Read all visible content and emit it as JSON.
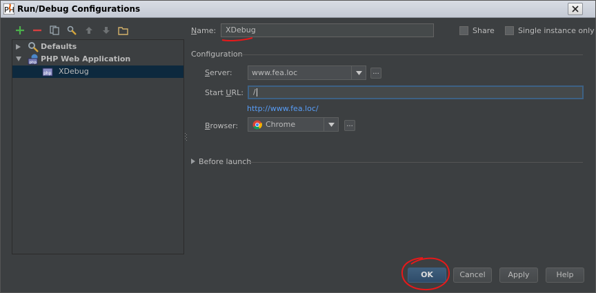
{
  "window": {
    "title": "Run/Debug Configurations"
  },
  "toolbar": {
    "icons": [
      "add-icon",
      "remove-icon",
      "copy-icon",
      "edit-defaults-icon",
      "move-up-icon",
      "move-down-icon",
      "folder-icon"
    ]
  },
  "tree": {
    "items": [
      {
        "label": "Defaults"
      },
      {
        "label": "PHP Web Application"
      },
      {
        "label": "XDebug"
      }
    ]
  },
  "form": {
    "name_label": "Name:",
    "name_value": "XDebug",
    "share_label": "Share",
    "single_instance_label": "Single instance only",
    "configuration_label": "Configuration",
    "server_label": "Server:",
    "server_value": "www.fea.loc",
    "start_url_label": "Start URL:",
    "start_url_value": "/",
    "resolved_url": "http://www.fea.loc/",
    "browser_label": "Browser:",
    "browser_value": "Chrome",
    "before_launch_label": "Before launch",
    "ellipsis": "..."
  },
  "buttons": {
    "ok": "OK",
    "cancel": "Cancel",
    "apply": "Apply",
    "help": "Help"
  },
  "colors": {
    "background": "#3c3f41",
    "selection": "#0d293e",
    "link": "#589df6",
    "annotation": "#e8191a"
  }
}
